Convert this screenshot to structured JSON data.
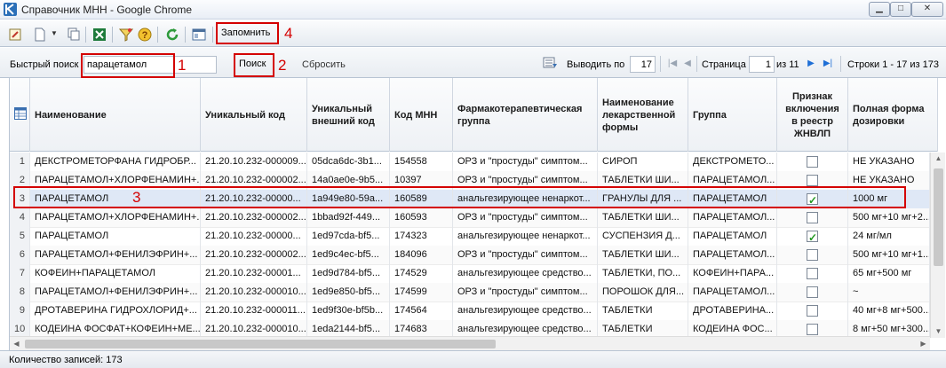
{
  "window": {
    "title": "Справочник МНН - Google Chrome"
  },
  "toolbar": {
    "icons": [
      "edit-icon",
      "new-document-icon",
      "copy-icon",
      "excel-export-icon",
      "filter-icon",
      "help-icon",
      "refresh-icon",
      "window-icon"
    ],
    "remember_label": "Запомнить"
  },
  "search": {
    "label": "Быстрый поиск",
    "value": "парацетамол",
    "search_label": "Поиск",
    "reset_label": "Сбросить"
  },
  "pager": {
    "per_page_label": "Выводить по",
    "per_page_value": "17",
    "page_label": "Страница",
    "page_value": "1",
    "of_label": "из 11",
    "rows_info": "Строки 1 - 17 из 173"
  },
  "grid": {
    "columns": [
      "Наименование",
      "Уникальный код",
      "Уникальный внешний код",
      "Код МНН",
      "Фармакотерапевтическая группа",
      "Наименование лекарственной формы",
      "Группа",
      "Признак включения в реестр ЖНВЛП",
      "Полная форма дозировки"
    ],
    "rows": [
      {
        "n": "1",
        "name": "ДЕКСТРОМЕТОРФАНА ГИДРОБР...",
        "code": "21.20.10.232-000009...",
        "ext": "05dca6dc-3b1...",
        "mnn": "154558",
        "pharm": "ОРЗ и \"простуды\" симптом...",
        "form": "СИРОП",
        "group": "ДЕКСТРОМЕТО...",
        "zhnvlp": false,
        "dose": "НЕ УКАЗАНО"
      },
      {
        "n": "2",
        "name": "ПАРАЦЕТАМОЛ+ХЛОРФЕНАМИН+...",
        "code": "21.20.10.232-000002...",
        "ext": "14a0ae0e-9b5...",
        "mnn": "10397",
        "pharm": "ОРЗ и \"простуды\" симптом...",
        "form": "ТАБЛЕТКИ ШИ...",
        "group": "ПАРАЦЕТАМОЛ...",
        "zhnvlp": false,
        "dose": "НЕ УКАЗАНО"
      },
      {
        "n": "3",
        "name": "ПАРАЦЕТАМОЛ",
        "code": "21.20.10.232-00000...",
        "ext": "1a949e80-59a...",
        "mnn": "160589",
        "pharm": "анальгезирующее ненаркот...",
        "form": "ГРАНУЛЫ ДЛЯ ...",
        "group": "ПАРАЦЕТАМОЛ",
        "zhnvlp": true,
        "dose": "1000 мг"
      },
      {
        "n": "4",
        "name": "ПАРАЦЕТАМОЛ+ХЛОРФЕНАМИН+...",
        "code": "21.20.10.232-000002...",
        "ext": "1bbad92f-449...",
        "mnn": "160593",
        "pharm": "ОРЗ и \"простуды\" симптом...",
        "form": "ТАБЛЕТКИ ШИ...",
        "group": "ПАРАЦЕТАМОЛ...",
        "zhnvlp": false,
        "dose": "500 мг+10 мг+2..."
      },
      {
        "n": "5",
        "name": "ПАРАЦЕТАМОЛ",
        "code": "21.20.10.232-00000...",
        "ext": "1ed97cda-bf5...",
        "mnn": "174323",
        "pharm": "анальгезирующее ненаркот...",
        "form": "СУСПЕНЗИЯ Д...",
        "group": "ПАРАЦЕТАМОЛ",
        "zhnvlp": true,
        "dose": "24 мг/мл"
      },
      {
        "n": "6",
        "name": "ПАРАЦЕТАМОЛ+ФЕНИЛЭФРИН+...",
        "code": "21.20.10.232-000002...",
        "ext": "1ed9c4ec-bf5...",
        "mnn": "184096",
        "pharm": "ОРЗ и \"простуды\" симптом...",
        "form": "ТАБЛЕТКИ ШИ...",
        "group": "ПАРАЦЕТАМОЛ...",
        "zhnvlp": false,
        "dose": "500 мг+10 мг+1..."
      },
      {
        "n": "7",
        "name": "КОФЕИН+ПАРАЦЕТАМОЛ",
        "code": "21.20.10.232-00001...",
        "ext": "1ed9d784-bf5...",
        "mnn": "174529",
        "pharm": "анальгезирующее средство...",
        "form": "ТАБЛЕТКИ, ПО...",
        "group": "КОФЕИН+ПАРА...",
        "zhnvlp": false,
        "dose": "65 мг+500 мг"
      },
      {
        "n": "8",
        "name": "ПАРАЦЕТАМОЛ+ФЕНИЛЭФРИН+...",
        "code": "21.20.10.232-000010...",
        "ext": "1ed9e850-bf5...",
        "mnn": "174599",
        "pharm": "ОРЗ и \"простуды\" симптом...",
        "form": "ПОРОШОК ДЛЯ...",
        "group": "ПАРАЦЕТАМОЛ...",
        "zhnvlp": false,
        "dose": "~"
      },
      {
        "n": "9",
        "name": "ДРОТАВЕРИНА ГИДРОХЛОРИД+...",
        "code": "21.20.10.232-000011...",
        "ext": "1ed9f30e-bf5b...",
        "mnn": "174564",
        "pharm": "анальгезирующее средство...",
        "form": "ТАБЛЕТКИ",
        "group": "ДРОТАВЕРИНА...",
        "zhnvlp": false,
        "dose": "40 мг+8 мг+500..."
      },
      {
        "n": "10",
        "name": "КОДЕИНА ФОСФАТ+КОФЕИН+МЕ...",
        "code": "21.20.10.232-000010...",
        "ext": "1eda2144-bf5...",
        "mnn": "174683",
        "pharm": "анальгезирующее средство...",
        "form": "ТАБЛЕТКИ",
        "group": "КОДЕИНА ФОС...",
        "zhnvlp": false,
        "dose": "8 мг+50 мг+300..."
      }
    ]
  },
  "status": {
    "text": "Количество записей: 173"
  },
  "annotations": [
    "1",
    "2",
    "3",
    "4"
  ],
  "colors": {
    "annotation": "#d40000",
    "selected_row": "#dfe8f6",
    "check": "#229922"
  }
}
